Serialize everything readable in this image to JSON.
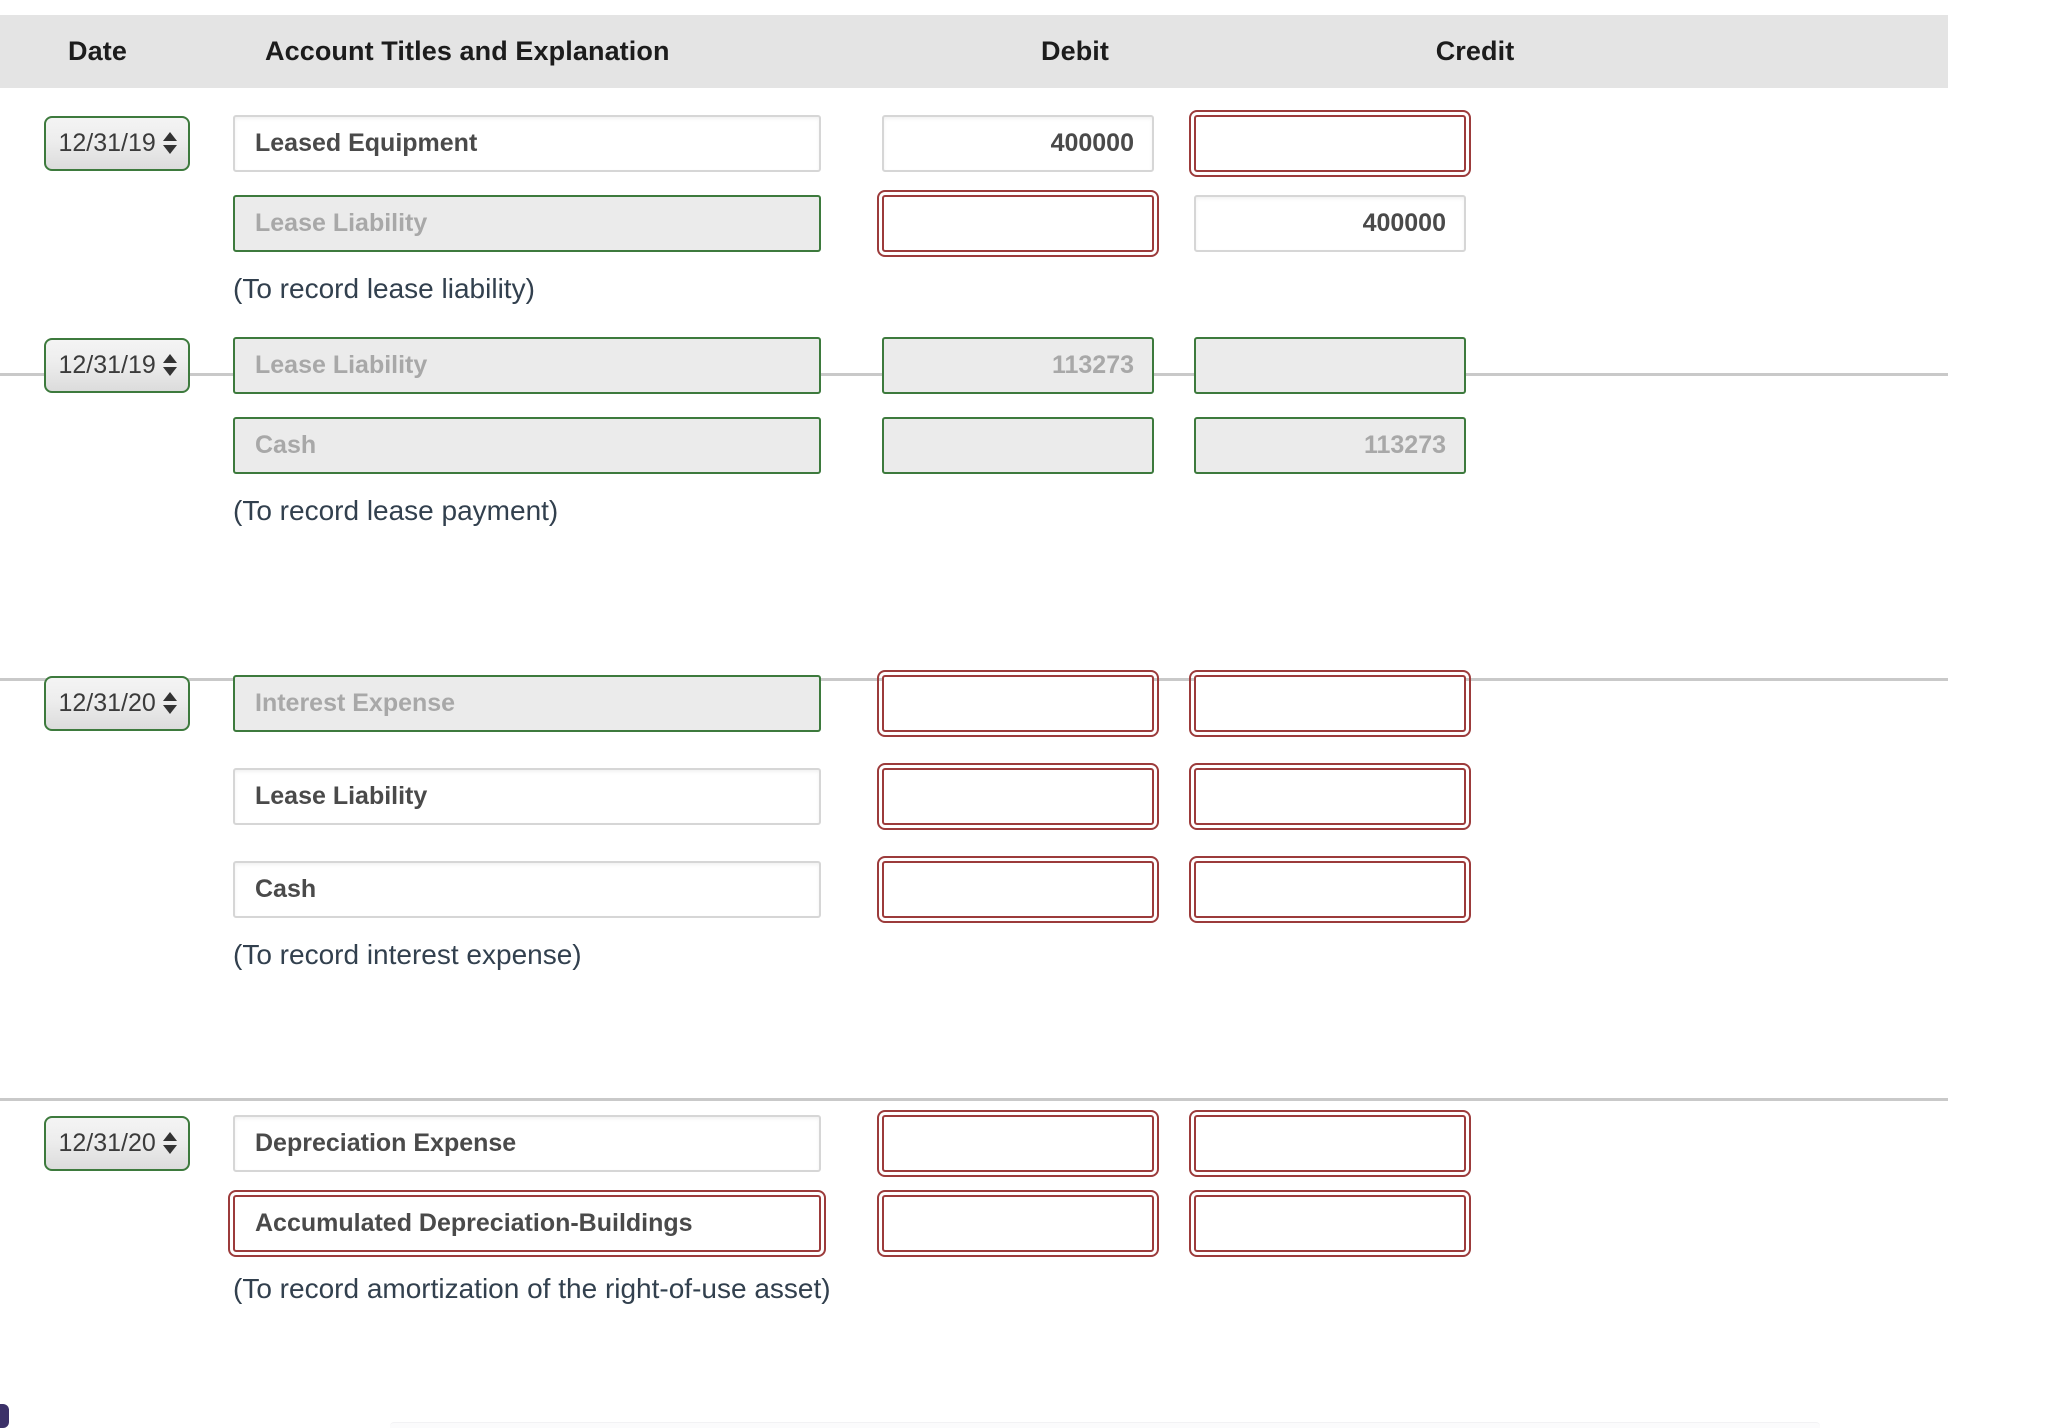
{
  "header": {
    "date": "Date",
    "account": "Account Titles and Explanation",
    "debit": "Debit",
    "credit": "Credit"
  },
  "colors": {
    "header_bg": "#e4e4e4",
    "error_border": "#9c3b3b",
    "disabled_border": "#3d7a3d",
    "disabled_bg": "#ebebeb",
    "caption_text": "#32404e"
  },
  "icons": {
    "spinner_up": "spinner-up-arrow-icon",
    "spinner_down": "spinner-down-arrow-icon"
  },
  "entries": [
    {
      "date": "12/31/19",
      "caption": "(To record lease liability)",
      "lines": [
        {
          "account": {
            "value": "Leased Equipment",
            "state": "normal"
          },
          "debit": {
            "value": "400000",
            "state": "normal"
          },
          "credit": {
            "value": "",
            "state": "error"
          }
        },
        {
          "account": {
            "value": "Lease Liability",
            "state": "disabled"
          },
          "debit": {
            "value": "",
            "state": "error"
          },
          "credit": {
            "value": "400000",
            "state": "normal"
          }
        }
      ]
    },
    {
      "date": "12/31/19",
      "caption": "(To record lease payment)",
      "lines": [
        {
          "account": {
            "value": "Lease Liability",
            "state": "disabled"
          },
          "debit": {
            "value": "113273",
            "state": "disabled"
          },
          "credit": {
            "value": "",
            "state": "disabled"
          }
        },
        {
          "account": {
            "value": "Cash",
            "state": "disabled"
          },
          "debit": {
            "value": "",
            "state": "disabled"
          },
          "credit": {
            "value": "113273",
            "state": "disabled"
          }
        }
      ]
    },
    {
      "date": "12/31/20",
      "caption": "(To record interest expense)",
      "lines": [
        {
          "account": {
            "value": "Interest Expense",
            "state": "disabled"
          },
          "debit": {
            "value": "",
            "state": "error"
          },
          "credit": {
            "value": "",
            "state": "error"
          }
        },
        {
          "account": {
            "value": "Lease Liability",
            "state": "normal"
          },
          "debit": {
            "value": "",
            "state": "error"
          },
          "credit": {
            "value": "",
            "state": "error"
          }
        },
        {
          "account": {
            "value": "Cash",
            "state": "normal"
          },
          "debit": {
            "value": "",
            "state": "error"
          },
          "credit": {
            "value": "",
            "state": "error"
          }
        }
      ]
    },
    {
      "date": "12/31/20",
      "caption": "(To record amortization of the right-of-use asset)",
      "lines": [
        {
          "account": {
            "value": "Depreciation Expense",
            "state": "normal"
          },
          "debit": {
            "value": "",
            "state": "error"
          },
          "credit": {
            "value": "",
            "state": "error"
          }
        },
        {
          "account": {
            "value": "Accumulated Depreciation-Buildings",
            "state": "error"
          },
          "debit": {
            "value": "",
            "state": "error"
          },
          "credit": {
            "value": "",
            "state": "error"
          }
        }
      ]
    }
  ]
}
